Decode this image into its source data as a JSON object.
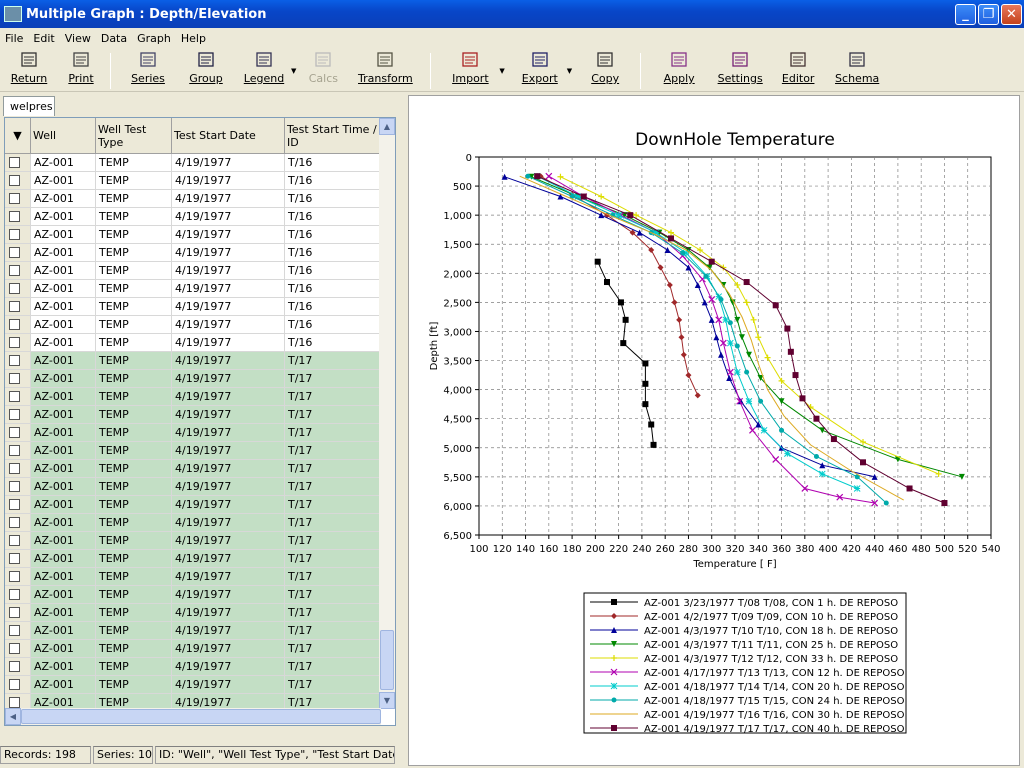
{
  "window": {
    "title": "Multiple Graph : Depth/Elevation"
  },
  "menu": [
    "File",
    "Edit",
    "View",
    "Data",
    "Graph",
    "Help"
  ],
  "toolbar": [
    {
      "label": "Return",
      "icon": "return-arrow-icon"
    },
    {
      "label": "Print",
      "icon": "print-icon"
    },
    {
      "label": "Series",
      "icon": "series-icon"
    },
    {
      "label": "Group",
      "icon": "group-icon"
    },
    {
      "label": "Legend",
      "icon": "legend-icon"
    },
    {
      "label": "Calcs",
      "icon": "calcs-icon",
      "disabled": true
    },
    {
      "label": "Transform",
      "icon": "transform-icon"
    },
    {
      "label": "Import",
      "icon": "import-icon"
    },
    {
      "label": "Export",
      "icon": "export-icon"
    },
    {
      "label": "Copy",
      "icon": "copy-icon"
    },
    {
      "label": "Apply",
      "icon": "apply-icon"
    },
    {
      "label": "Settings",
      "icon": "settings-icon"
    },
    {
      "label": "Editor",
      "icon": "editor-icon"
    },
    {
      "label": "Schema",
      "icon": "schema-icon"
    }
  ],
  "tab": "welpres",
  "grid": {
    "columns": [
      "Well",
      "Well Test Type",
      "Test Start Date",
      "Test Start Time / ID"
    ],
    "rows": [
      [
        "AZ-001",
        "TEMP",
        "4/19/1977",
        "T/16"
      ],
      [
        "AZ-001",
        "TEMP",
        "4/19/1977",
        "T/16"
      ],
      [
        "AZ-001",
        "TEMP",
        "4/19/1977",
        "T/16"
      ],
      [
        "AZ-001",
        "TEMP",
        "4/19/1977",
        "T/16"
      ],
      [
        "AZ-001",
        "TEMP",
        "4/19/1977",
        "T/16"
      ],
      [
        "AZ-001",
        "TEMP",
        "4/19/1977",
        "T/16"
      ],
      [
        "AZ-001",
        "TEMP",
        "4/19/1977",
        "T/16"
      ],
      [
        "AZ-001",
        "TEMP",
        "4/19/1977",
        "T/16"
      ],
      [
        "AZ-001",
        "TEMP",
        "4/19/1977",
        "T/16"
      ],
      [
        "AZ-001",
        "TEMP",
        "4/19/1977",
        "T/16"
      ],
      [
        "AZ-001",
        "TEMP",
        "4/19/1977",
        "T/16"
      ],
      [
        "AZ-001",
        "TEMP",
        "4/19/1977",
        "T/17"
      ],
      [
        "AZ-001",
        "TEMP",
        "4/19/1977",
        "T/17"
      ],
      [
        "AZ-001",
        "TEMP",
        "4/19/1977",
        "T/17"
      ],
      [
        "AZ-001",
        "TEMP",
        "4/19/1977",
        "T/17"
      ],
      [
        "AZ-001",
        "TEMP",
        "4/19/1977",
        "T/17"
      ],
      [
        "AZ-001",
        "TEMP",
        "4/19/1977",
        "T/17"
      ],
      [
        "AZ-001",
        "TEMP",
        "4/19/1977",
        "T/17"
      ],
      [
        "AZ-001",
        "TEMP",
        "4/19/1977",
        "T/17"
      ],
      [
        "AZ-001",
        "TEMP",
        "4/19/1977",
        "T/17"
      ],
      [
        "AZ-001",
        "TEMP",
        "4/19/1977",
        "T/17"
      ],
      [
        "AZ-001",
        "TEMP",
        "4/19/1977",
        "T/17"
      ],
      [
        "AZ-001",
        "TEMP",
        "4/19/1977",
        "T/17"
      ],
      [
        "AZ-001",
        "TEMP",
        "4/19/1977",
        "T/17"
      ],
      [
        "AZ-001",
        "TEMP",
        "4/19/1977",
        "T/17"
      ],
      [
        "AZ-001",
        "TEMP",
        "4/19/1977",
        "T/17"
      ],
      [
        "AZ-001",
        "TEMP",
        "4/19/1977",
        "T/17"
      ],
      [
        "AZ-001",
        "TEMP",
        "4/19/1977",
        "T/17"
      ],
      [
        "AZ-001",
        "TEMP",
        "4/19/1977",
        "T/17"
      ],
      [
        "AZ-001",
        "TEMP",
        "4/19/1977",
        "T/17"
      ],
      [
        "AZ-001",
        "TEMP",
        "4/19/1977",
        "T/17"
      ],
      [
        "AZ-001",
        "TEMP",
        "4/19/1977",
        "T/17"
      ],
      [
        "AZ-001",
        "TEMP",
        "4/19/1977",
        "T/17"
      ]
    ],
    "highlight_from": 11,
    "selected_row": 31
  },
  "status": {
    "records": "Records: 198",
    "series": "Series: 10",
    "id": "ID: \"Well\", \"Well Test Type\", \"Test Start Date\", \""
  },
  "chart_data": {
    "type": "line",
    "title": "DownHole Temperature",
    "xlabel": "Temperature [ F]",
    "ylabel": "Depth [ft]",
    "xlim": [
      100,
      540
    ],
    "ylim": [
      0,
      6500
    ],
    "y_inverted": true,
    "xticks": [
      100,
      120,
      140,
      160,
      180,
      200,
      220,
      240,
      260,
      280,
      300,
      320,
      340,
      360,
      380,
      400,
      420,
      440,
      460,
      480,
      500,
      520,
      540
    ],
    "yticks": [
      0,
      500,
      1000,
      1500,
      2000,
      2500,
      3000,
      3500,
      4000,
      4500,
      5000,
      5500,
      6000,
      6500
    ],
    "ytick_labels": [
      "0",
      "500",
      "1,000",
      "1,500",
      "2,000",
      "2,500",
      "3,000",
      "3,500",
      "4,000",
      "4,500",
      "5,000",
      "5,500",
      "6,000",
      "6,500"
    ],
    "grid": true,
    "legend_position": "bottom",
    "series": [
      {
        "name": "AZ-001 3/23/1977 T/08 T/08, CON 1 h. DE REPOSO",
        "color": "#000000",
        "marker": "square",
        "x": [
          202,
          210,
          222,
          226,
          224,
          243,
          243,
          243,
          248,
          250
        ],
        "y": [
          1800,
          2150,
          2500,
          2800,
          3200,
          3550,
          3900,
          4250,
          4600,
          4950
        ]
      },
      {
        "name": "AZ-001 4/2/1977 T/09 T/09, CON 10 h. DE REPOSO",
        "color": "#a0282a",
        "marker": "diamond",
        "x": [
          153,
          180,
          210,
          232,
          248,
          256,
          264,
          268,
          272,
          274,
          276,
          280,
          288
        ],
        "y": [
          330,
          650,
          1000,
          1300,
          1600,
          1900,
          2200,
          2500,
          2800,
          3100,
          3400,
          3750,
          4100
        ]
      },
      {
        "name": "AZ-001 4/3/1977 T/10 T/10, CON 18 h. DE REPOSO",
        "color": "#000099",
        "marker": "triangle",
        "x": [
          122,
          170,
          205,
          238,
          262,
          280,
          288,
          294,
          300,
          304,
          308,
          315,
          325,
          340,
          360,
          395,
          440
        ],
        "y": [
          340,
          680,
          1000,
          1300,
          1600,
          1900,
          2200,
          2500,
          2800,
          3100,
          3400,
          3800,
          4200,
          4600,
          5000,
          5300,
          5500
        ]
      },
      {
        "name": "AZ-001 4/3/1977 T/11 T/11, CON 25 h. DE REPOSO",
        "color": "#008800",
        "marker": "triangle-down",
        "x": [
          145,
          185,
          225,
          255,
          280,
          298,
          310,
          318,
          322,
          326,
          332,
          342,
          360,
          395,
          460,
          515
        ],
        "y": [
          340,
          680,
          1000,
          1300,
          1600,
          1900,
          2200,
          2500,
          2800,
          3100,
          3400,
          3800,
          4200,
          4700,
          5200,
          5500
        ]
      },
      {
        "name": "AZ-001 4/3/1977 T/12 T/12, CON 33 h. DE REPOSO",
        "color": "#dddd00",
        "marker": "plus",
        "x": [
          170,
          205,
          235,
          265,
          290,
          310,
          322,
          330,
          336,
          340,
          348,
          360,
          385,
          430,
          495
        ],
        "y": [
          340,
          680,
          1000,
          1300,
          1600,
          1900,
          2200,
          2500,
          2800,
          3100,
          3450,
          3850,
          4300,
          4900,
          5450
        ]
      },
      {
        "name": "AZ-001 4/17/1977 T/13 T/13, CON 12 h. DE REPOSO",
        "color": "#b000b0",
        "marker": "x",
        "x": [
          160,
          190,
          222,
          252,
          275,
          292,
          300,
          306,
          310,
          316,
          324,
          335,
          355,
          380,
          410,
          440
        ],
        "y": [
          330,
          680,
          1000,
          1300,
          1700,
          2100,
          2450,
          2800,
          3200,
          3700,
          4200,
          4700,
          5200,
          5700,
          5850,
          5950
        ]
      },
      {
        "name": "AZ-001 4/18/1977 T/14 T/14, CON 20 h. DE REPOSO",
        "color": "#00cccc",
        "marker": "star",
        "x": [
          150,
          185,
          220,
          252,
          278,
          296,
          306,
          312,
          316,
          322,
          332,
          345,
          365,
          395,
          425
        ],
        "y": [
          330,
          680,
          1000,
          1300,
          1650,
          2050,
          2400,
          2800,
          3200,
          3700,
          4200,
          4700,
          5100,
          5450,
          5700
        ]
      },
      {
        "name": "AZ-001 4/18/1977 T/15 T/15, CON 24 h. DE REPOSO",
        "color": "#00aaaa",
        "marker": "circle",
        "x": [
          142,
          180,
          215,
          248,
          275,
          295,
          308,
          316,
          322,
          330,
          342,
          360,
          390,
          425,
          450
        ],
        "y": [
          330,
          680,
          1000,
          1300,
          1650,
          2050,
          2450,
          2850,
          3250,
          3700,
          4200,
          4700,
          5150,
          5500,
          5950
        ]
      },
      {
        "name": "AZ-001 4/19/1977 T/16 T/16, CON 30 h. DE REPOSO",
        "color": "#ddaa22",
        "marker": "none",
        "x": [
          135,
          175,
          212,
          248,
          278,
          300,
          315,
          326,
          334,
          340,
          348,
          362,
          385,
          420,
          465
        ],
        "y": [
          330,
          680,
          1000,
          1300,
          1600,
          1950,
          2350,
          2750,
          3150,
          3550,
          4000,
          4450,
          4950,
          5400,
          5900
        ]
      },
      {
        "name": "AZ-001 4/19/1977 T/17 T/17, CON 40 h. DE REPOSO",
        "color": "#600030",
        "marker": "square",
        "x": [
          150,
          190,
          230,
          265,
          300,
          330,
          355,
          365,
          368,
          372,
          378,
          390,
          405,
          430,
          470,
          500
        ],
        "y": [
          330,
          680,
          1000,
          1400,
          1800,
          2150,
          2550,
          2950,
          3350,
          3750,
          4150,
          4500,
          4850,
          5250,
          5700,
          5950
        ]
      }
    ]
  }
}
